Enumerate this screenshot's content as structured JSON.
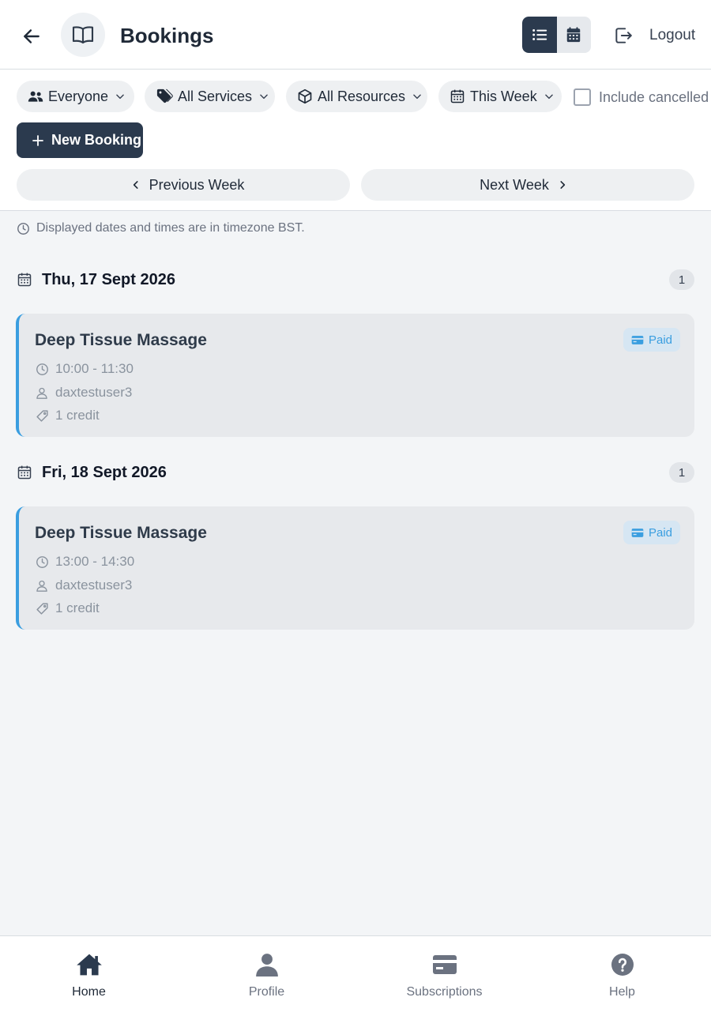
{
  "header": {
    "title": "Bookings",
    "logout_label": "Logout",
    "view_mode": "list"
  },
  "filters": {
    "people": "Everyone",
    "services": "All Services",
    "resources": "All Resources",
    "period": "This Week",
    "include_cancelled_label": "Include cancelled",
    "include_cancelled_checked": false,
    "new_booking_label": "New Booking",
    "previous_week_label": "Previous Week",
    "next_week_label": "Next Week"
  },
  "timezone_note": "Displayed dates and times are in timezone BST.",
  "days": [
    {
      "date": "Thu, 17 Sept 2026",
      "count": "1",
      "bookings": [
        {
          "service": "Deep Tissue Massage",
          "status": "Paid",
          "time": "10:00 - 11:30",
          "user": "daxtestuser3",
          "cost": "1 credit"
        }
      ]
    },
    {
      "date": "Fri, 18 Sept 2026",
      "count": "1",
      "bookings": [
        {
          "service": "Deep Tissue Massage",
          "status": "Paid",
          "time": "13:00 - 14:30",
          "user": "daxtestuser3",
          "cost": "1 credit"
        }
      ]
    }
  ],
  "nav": [
    {
      "label": "Home",
      "icon": "home-icon",
      "active": true
    },
    {
      "label": "Profile",
      "icon": "user-icon",
      "active": false
    },
    {
      "label": "Subscriptions",
      "icon": "card-icon",
      "active": false
    },
    {
      "label": "Help",
      "icon": "help-icon",
      "active": false
    }
  ],
  "colors": {
    "primary": "#2b3a4e",
    "accent": "#3a9ee0",
    "card_bg": "#e7e9ec",
    "page_bg": "#f3f5f7"
  }
}
